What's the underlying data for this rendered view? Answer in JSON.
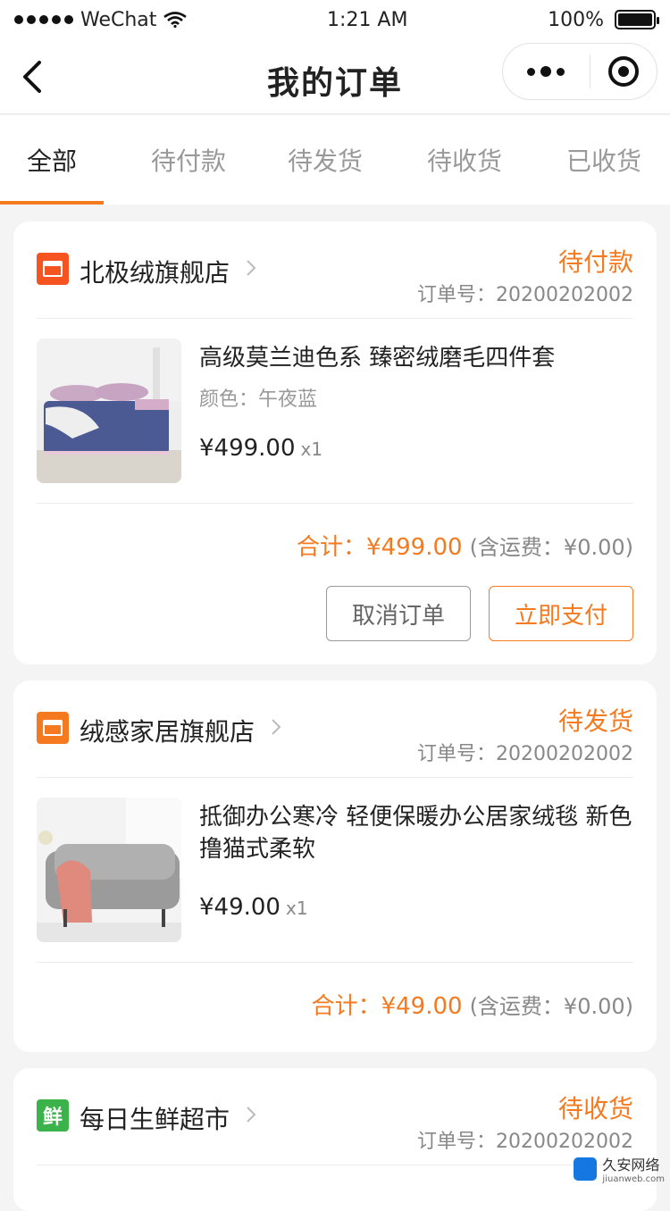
{
  "statusbar": {
    "carrier": "WeChat",
    "time": "1:21 AM",
    "battery": "100%"
  },
  "navbar": {
    "title": "我的订单"
  },
  "tabs": [
    {
      "label": "全部",
      "active": true
    },
    {
      "label": "待付款",
      "active": false
    },
    {
      "label": "待发货",
      "active": false
    },
    {
      "label": "待收货",
      "active": false
    },
    {
      "label": "已收货",
      "active": false
    }
  ],
  "orders": [
    {
      "store": "北极绒旗舰店",
      "store_icon": "shop-icon",
      "store_color": "#f5531f",
      "status": "待付款",
      "order_no": "订单号：20200202002",
      "product": {
        "title": "高级莫兰迪色系  臻密绒磨毛四件套",
        "spec": "颜色：午夜蓝",
        "price": "¥499.00",
        "qty": "x1"
      },
      "total": "合计：¥499.00",
      "shipping": "(含运费：¥0.00)",
      "buttons": {
        "cancel": "取消订单",
        "pay": "立即支付"
      }
    },
    {
      "store": "绒感家居旗舰店",
      "store_icon": "shop-icon",
      "store_color": "#f57a1f",
      "status": "待发货",
      "order_no": "订单号：20200202002",
      "product": {
        "title": "抵御办公寒冷 轻便保暖办公居家绒毯 新色  撸猫式柔软",
        "spec": "",
        "price": "¥49.00",
        "qty": "x1"
      },
      "total": "合计：¥49.00",
      "shipping": "(含运费：¥0.00)"
    },
    {
      "store": "每日生鲜超市",
      "store_icon": "fresh-icon",
      "store_glyph": "鲜",
      "store_color": "#3cb34a",
      "status": "待收货",
      "order_no": "订单号：20200202002"
    }
  ],
  "watermark": {
    "text": "久安网络",
    "sub": "jiuanweb.com"
  },
  "colors": {
    "accent": "#f57a1f",
    "inactive_tab": "#999999"
  }
}
